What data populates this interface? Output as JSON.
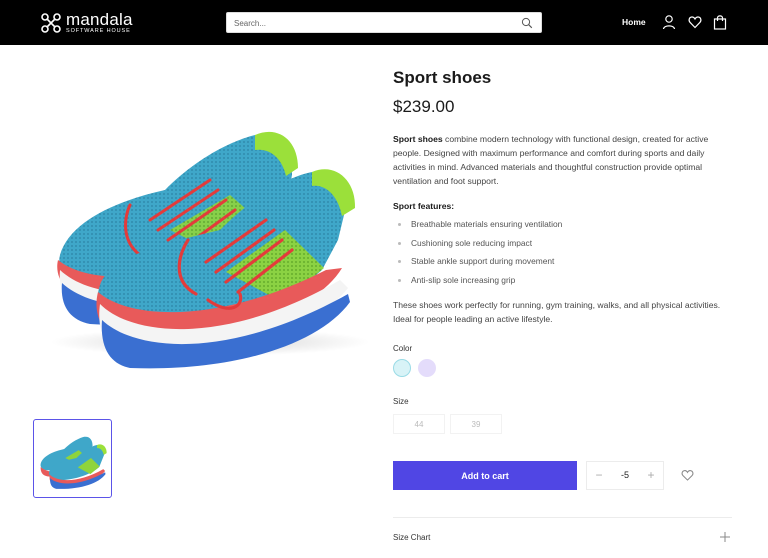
{
  "header": {
    "logo_name": "mandala",
    "logo_sub": "SOFTWARE HOUSE",
    "search_placeholder": "Search...",
    "nav_home": "Home",
    "icons": [
      "search-icon",
      "user-icon",
      "heart-icon",
      "bag-icon"
    ]
  },
  "product": {
    "title": "Sport shoes",
    "price": "$239.00",
    "description_lead": "Sport shoes",
    "description_rest": " combine modern technology with functional design, created for active people. Designed with maximum performance and comfort during sports and daily activities in mind. Advanced materials and thoughtful construction provide optimal ventilation and foot support.",
    "features_title": "Sport features:",
    "features": [
      "Breathable materials ensuring ventilation",
      "Cushioning sole reducing impact",
      "Stable ankle support during movement",
      "Anti-slip sole increasing grip"
    ],
    "closing": "These shoes work perfectly for running, gym training, walks, and all physical activities. Ideal for people leading an active lifestyle."
  },
  "options": {
    "color_label": "Color",
    "colors": [
      "#d8f3f7",
      "#e4dcfb"
    ],
    "size_label": "Size",
    "sizes": [
      "44",
      "39"
    ]
  },
  "cart": {
    "add_label": "Add to cart",
    "quantity": "-5",
    "minus": "−",
    "plus": "+"
  },
  "accordion": {
    "size_chart_label": "Size Chart"
  },
  "theme": {
    "accent": "#5046e4",
    "header_bg": "#000000"
  }
}
